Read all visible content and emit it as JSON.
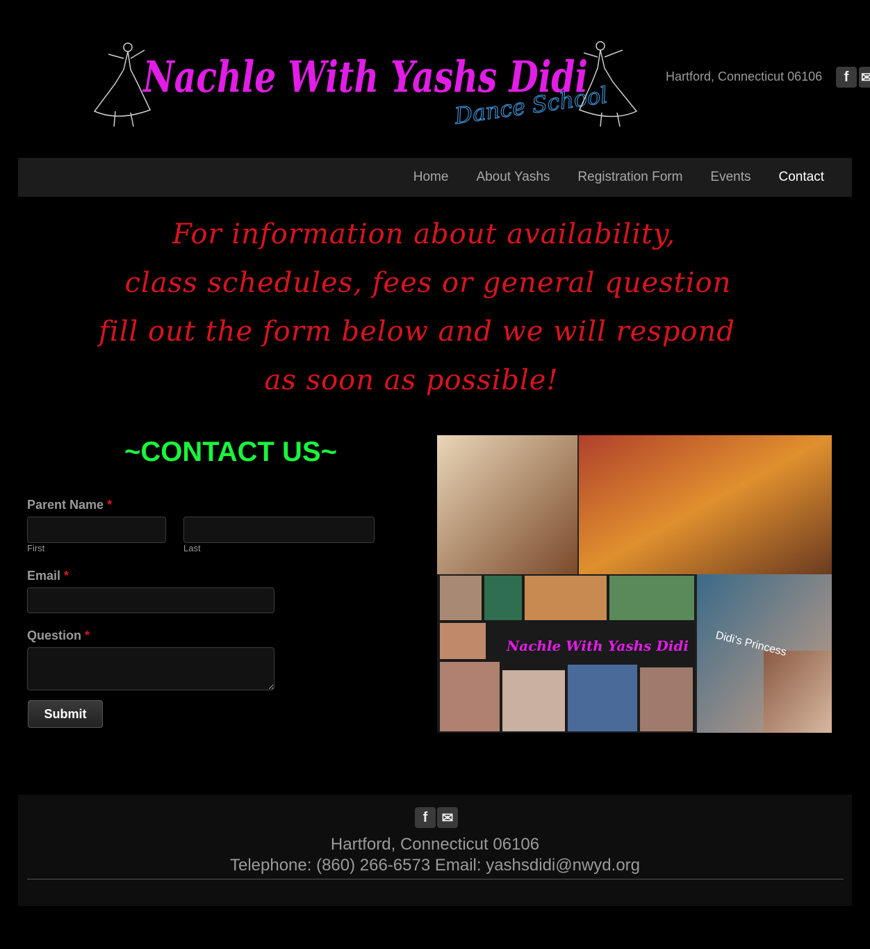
{
  "header": {
    "logo_text": "Nachle With Yashs Didi",
    "logo_subtext": "Dance School",
    "address": "Hartford, Connecticut 06106",
    "social_icons": [
      "facebook-icon",
      "email-icon"
    ]
  },
  "nav": {
    "items": [
      {
        "label": "Home"
      },
      {
        "label": "About Yashs"
      },
      {
        "label": "Registration Form"
      },
      {
        "label": "Events"
      },
      {
        "label": "Contact"
      }
    ],
    "active": "Contact"
  },
  "intro": {
    "lines": [
      "For information about availability,",
      "class schedules, fees or general question",
      "fill out the form below and we will respond",
      "as soon as possible!"
    ]
  },
  "form": {
    "title": "~CONTACT US~",
    "parent_name_label": "Parent Name",
    "required_mark": "*",
    "first_sublabel": "First",
    "last_sublabel": "Last",
    "email_label": "Email",
    "question_label": "Question",
    "submit_label": "Submit",
    "first_value": "",
    "last_value": "",
    "email_value": "",
    "question_value": ""
  },
  "collage": {
    "logo_text": "Nachle With Yashs Didi",
    "caption": "Didi's Princess"
  },
  "footer": {
    "address": "Hartford, Connecticut 06106",
    "contact": "Telephone: (860) 266-6573 Email: yashsdidi@nwyd.org"
  },
  "colors": {
    "logo_magenta": "#e11de6",
    "logo_blue": "#3c8fd0",
    "intro_red": "#d8141e",
    "title_green": "#1af53c",
    "required_red": "#e0141e"
  }
}
